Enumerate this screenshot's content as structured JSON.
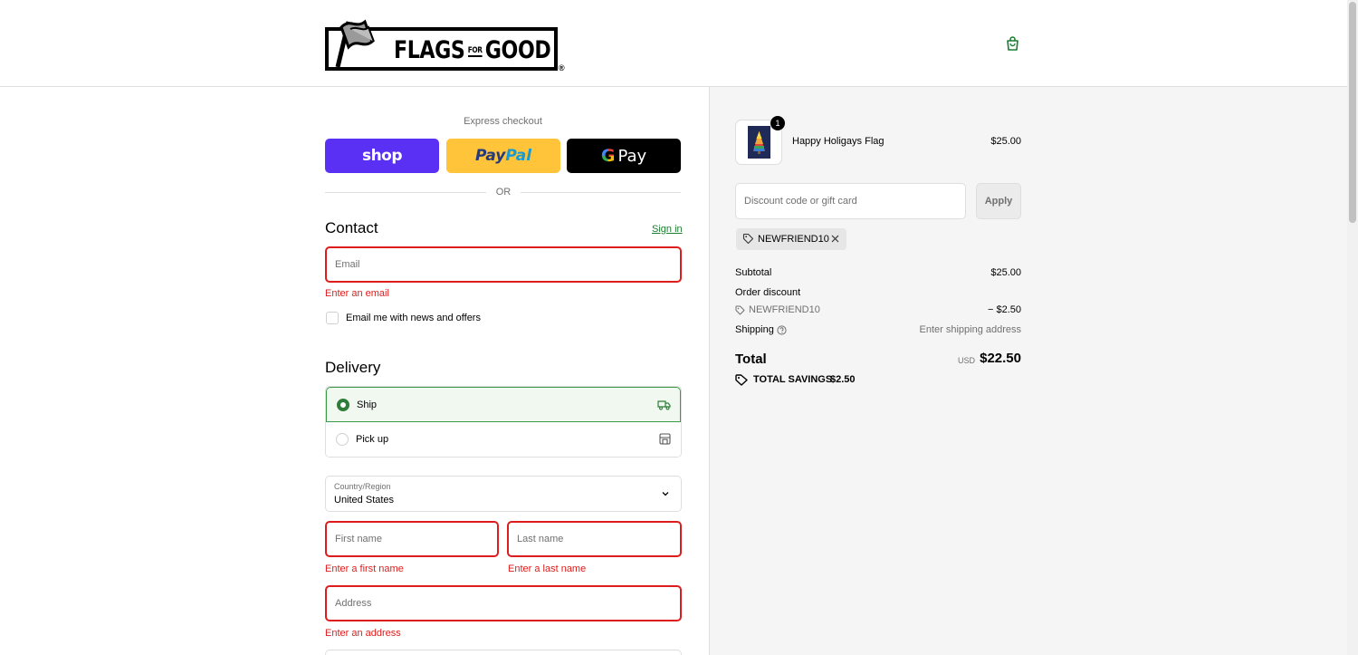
{
  "brand": {
    "name": "FLAGS FOR GOOD",
    "name_part1": "FLAGS",
    "name_small_1": "FOR",
    "name_part2": "GOOD",
    "reg_mark": "®"
  },
  "header": {
    "cart_icon": "shopping-bag-icon",
    "accent_color": "#1c7c31"
  },
  "express": {
    "label": "Express checkout",
    "shop_label": "shop",
    "paypal_label_1": "Pay",
    "paypal_label_2": "Pal",
    "gpay_g": "G",
    "gpay_label": "Pay",
    "or_label": "OR"
  },
  "contact": {
    "title": "Contact",
    "sign_in": "Sign in",
    "email_placeholder": "Email",
    "email_error": "Enter an email",
    "newsletter_label": "Email me with news and offers"
  },
  "delivery": {
    "title": "Delivery",
    "options": [
      {
        "label": "Ship",
        "selected": true,
        "icon": "truck-icon"
      },
      {
        "label": "Pick up",
        "selected": false,
        "icon": "store-icon"
      }
    ],
    "country_label": "Country/Region",
    "country_value": "United States",
    "first_name_placeholder": "First name",
    "first_name_error": "Enter a first name",
    "last_name_placeholder": "Last name",
    "last_name_error": "Enter a last name",
    "address_placeholder": "Address",
    "address_error": "Enter an address"
  },
  "summary": {
    "product": {
      "name": "Happy Holigays Flag",
      "price": "$25.00",
      "quantity": "1"
    },
    "discount_placeholder": "Discount code or gift card",
    "apply_label": "Apply",
    "applied_code": "NEWFRIEND10",
    "subtotal_label": "Subtotal",
    "subtotal_value": "$25.00",
    "order_discount_label": "Order discount",
    "discount_code": "NEWFRIEND10",
    "discount_value": "− $2.50",
    "shipping_label": "Shipping",
    "shipping_value": "Enter shipping address",
    "total_label": "Total",
    "currency": "USD",
    "total_value": "$22.50",
    "savings_label": "TOTAL SAVINGS",
    "savings_value": "$2.50"
  },
  "colors": {
    "error": "#dd1d1d",
    "shop": "#5a31f4",
    "paypal": "#ffc439",
    "gpay": "#000000",
    "selected_green": "#2f7d3a"
  }
}
